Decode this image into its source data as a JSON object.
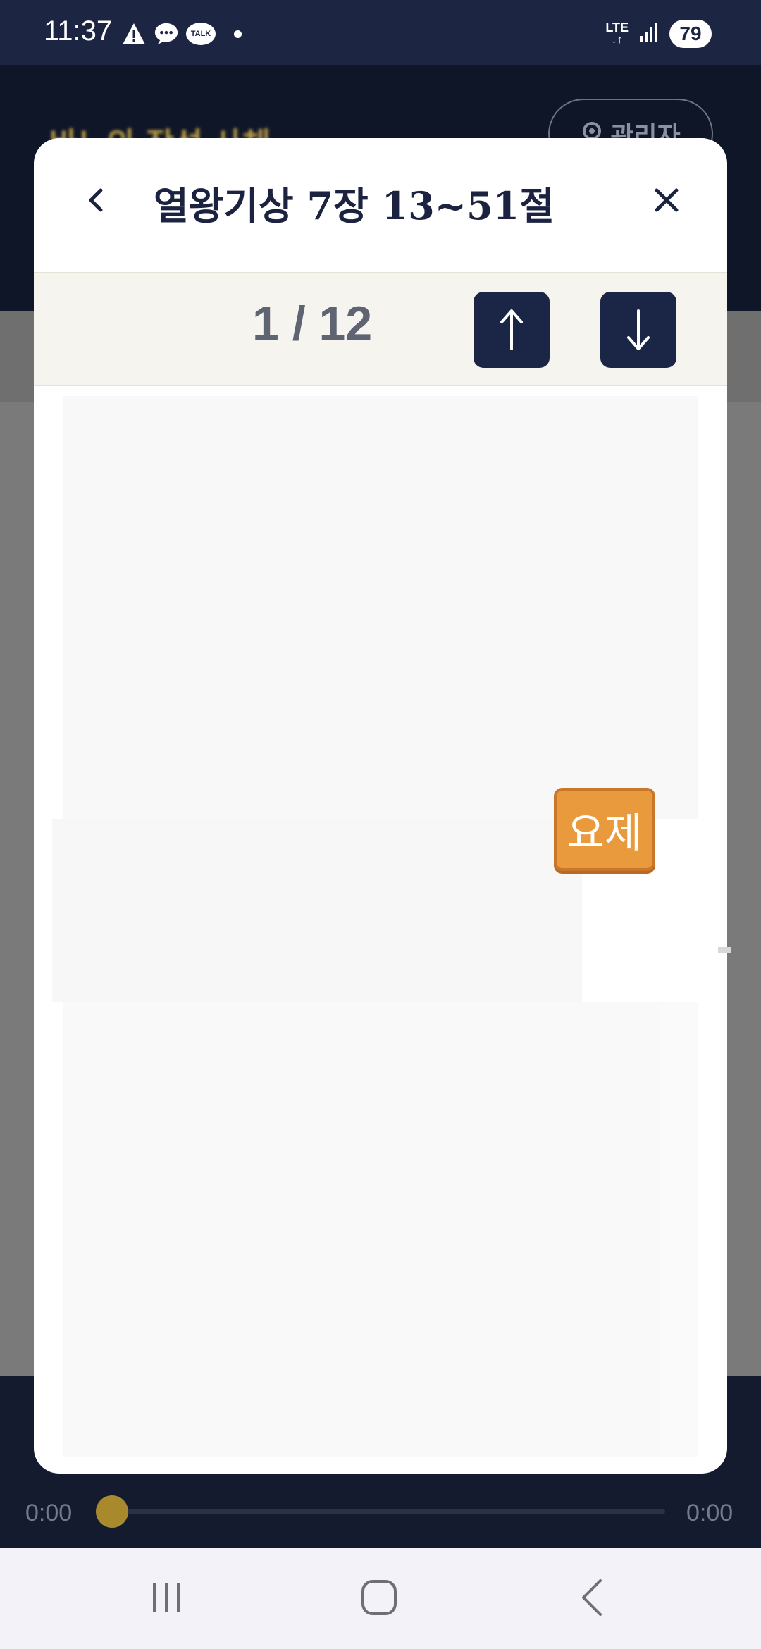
{
  "status_bar": {
    "time": "11:37",
    "left_icons": [
      "warning-icon",
      "message-icon",
      "kakaotalk-icon"
    ],
    "talk_label": "TALK",
    "network": "LTE",
    "battery": "79"
  },
  "app": {
    "header_title": "바느의 작성 사체",
    "admin_button": "관리자",
    "player": {
      "current_time": "0:00",
      "total_time": "0:00",
      "progress": 0
    }
  },
  "modal": {
    "title": "열왕기상 7장 13~51절",
    "pager": {
      "count_text": "1 / 12",
      "up_label": "↑",
      "down_label": "↓"
    },
    "sticker_text": "요제"
  },
  "colors": {
    "navy": "#1b2545",
    "gold": "#d6b24a",
    "sticker_orange": "#e99a3c"
  }
}
